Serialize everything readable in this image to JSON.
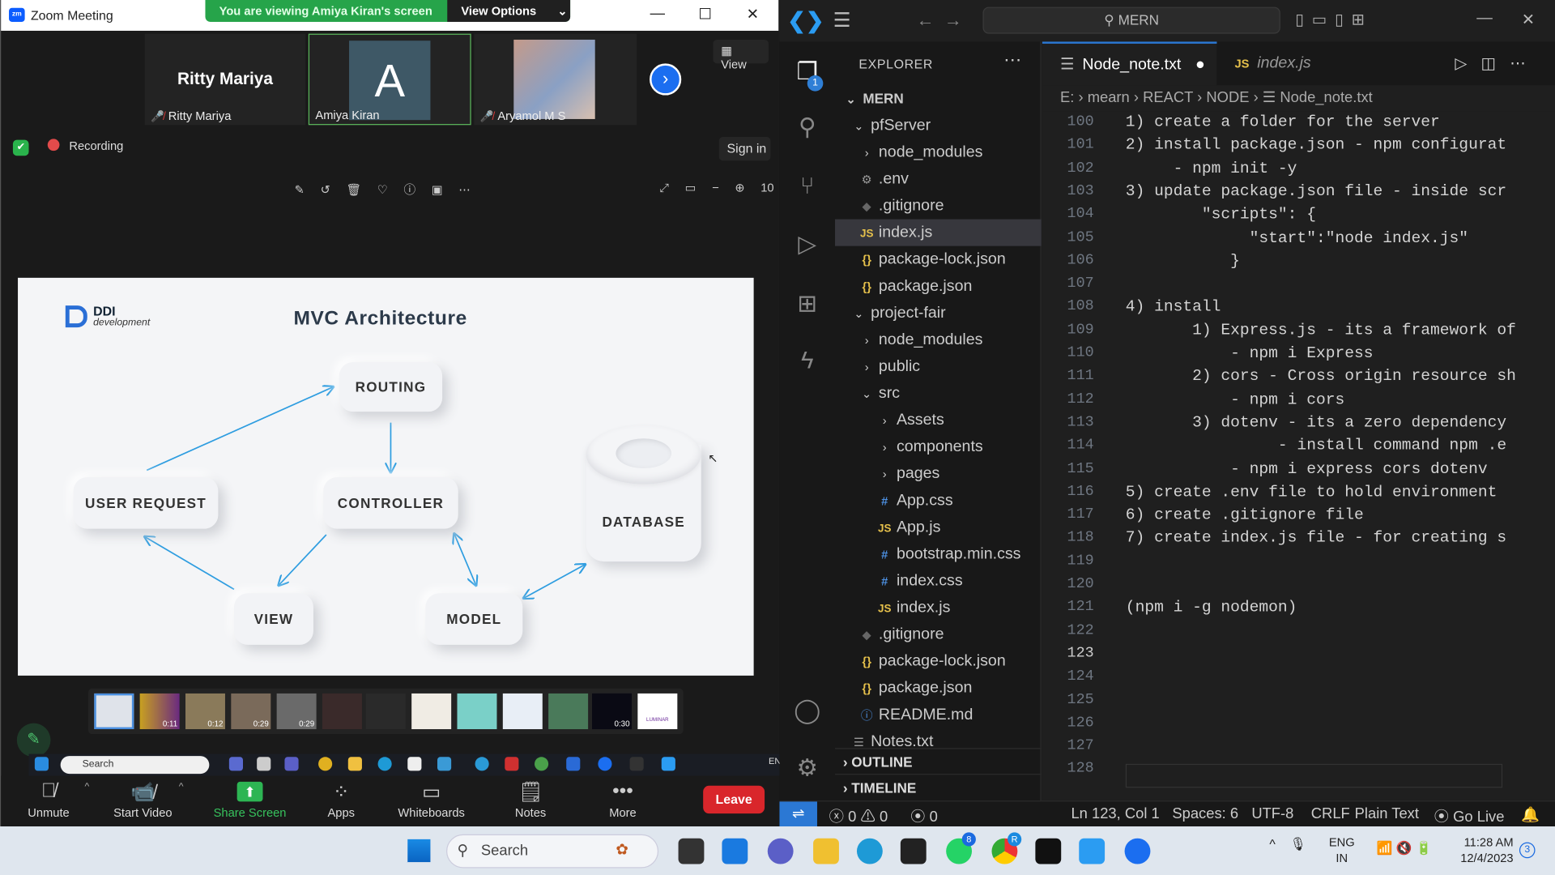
{
  "zoom": {
    "window_title": "Zoom Meeting",
    "viewing_banner": "You are viewing Amiya Kiran's screen",
    "view_options": "View Options",
    "participants": [
      {
        "name": "Ritty Mariya",
        "display": "Ritty Mariya",
        "muted": true
      },
      {
        "name": "Amiya Kiran",
        "avatar_letter": "A",
        "muted": false
      },
      {
        "name": "Aryamol M S",
        "muted": true
      }
    ],
    "view_button": "View",
    "recording": "Recording",
    "sign_in": "Sign in",
    "zoom_level": "10",
    "slide": {
      "brand": "DDI",
      "brand_sub": "development",
      "title": "MVC Architecture",
      "nodes": {
        "routing": "ROUTING",
        "user_request": "USER REQUEST",
        "controller": "CONTROLLER",
        "database": "DATABASE",
        "view": "VIEW",
        "model": "MODEL"
      }
    },
    "thumb_times": [
      "0:11",
      "0:12",
      "0:29",
      "0:29",
      "0:30"
    ],
    "thumb_brand": "LUMINAR",
    "mini_search": "Search",
    "mini_lang": "EN",
    "controls": [
      {
        "label": "Unmute",
        "icon": "mic-off-icon"
      },
      {
        "label": "Start Video",
        "icon": "video-off-icon"
      },
      {
        "label": "Share Screen",
        "icon": "share-screen-icon"
      },
      {
        "label": "Apps",
        "icon": "apps-icon"
      },
      {
        "label": "Whiteboards",
        "icon": "whiteboard-icon"
      },
      {
        "label": "Notes",
        "icon": "notes-icon"
      },
      {
        "label": "More",
        "icon": "more-icon"
      }
    ],
    "leave": "Leave"
  },
  "vscode": {
    "command_center": "MERN",
    "explorer_title": "EXPLORER",
    "root": "MERN",
    "tree": [
      {
        "label": "pfServer",
        "type": "folder-open",
        "depth": 1
      },
      {
        "label": "node_modules",
        "type": "folder",
        "depth": 2
      },
      {
        "label": ".env",
        "type": "env",
        "depth": 2
      },
      {
        "label": ".gitignore",
        "type": "git",
        "depth": 2
      },
      {
        "label": "index.js",
        "type": "js",
        "depth": 2,
        "selected": true
      },
      {
        "label": "package-lock.json",
        "type": "json",
        "depth": 2
      },
      {
        "label": "package.json",
        "type": "json",
        "depth": 2
      },
      {
        "label": "project-fair",
        "type": "folder-open",
        "depth": 1
      },
      {
        "label": "node_modules",
        "type": "folder",
        "depth": 2
      },
      {
        "label": "public",
        "type": "folder",
        "depth": 2
      },
      {
        "label": "src",
        "type": "folder-open",
        "depth": 2
      },
      {
        "label": "Assets",
        "type": "folder",
        "depth": 3
      },
      {
        "label": "components",
        "type": "folder",
        "depth": 3
      },
      {
        "label": "pages",
        "type": "folder",
        "depth": 3
      },
      {
        "label": "App.css",
        "type": "css",
        "depth": 3
      },
      {
        "label": "App.js",
        "type": "js",
        "depth": 3
      },
      {
        "label": "bootstrap.min.css",
        "type": "css",
        "depth": 3
      },
      {
        "label": "index.css",
        "type": "css",
        "depth": 3
      },
      {
        "label": "index.js",
        "type": "js",
        "depth": 3
      },
      {
        "label": ".gitignore",
        "type": "git",
        "depth": 2
      },
      {
        "label": "package-lock.json",
        "type": "json",
        "depth": 2
      },
      {
        "label": "package.json",
        "type": "json",
        "depth": 2
      },
      {
        "label": "README.md",
        "type": "info",
        "depth": 2
      },
      {
        "label": "Notes.txt",
        "type": "txt",
        "depth": 1
      }
    ],
    "outline": "OUTLINE",
    "timeline": "TIMELINE",
    "tabs": [
      {
        "label": "Node_note.txt",
        "active": true,
        "dirty": true
      },
      {
        "label": "index.js",
        "active": false
      }
    ],
    "breadcrumb": [
      "E:",
      "mearn",
      "REACT",
      "NODE",
      "Node_note.txt"
    ],
    "lines": [
      {
        "n": "100",
        "t": "1) create a folder for the server"
      },
      {
        "n": "101",
        "t": "2) install package.json - npm configurat"
      },
      {
        "n": "102",
        "t": "     - npm init -y"
      },
      {
        "n": "103",
        "t": "3) update package.json file - inside scr"
      },
      {
        "n": "104",
        "t": "        \"scripts\": {"
      },
      {
        "n": "105",
        "t": "             \"start\":\"node index.js\""
      },
      {
        "n": "106",
        "t": "           }"
      },
      {
        "n": "107",
        "t": ""
      },
      {
        "n": "108",
        "t": "4) install"
      },
      {
        "n": "109",
        "t": "       1) Express.js - its a framework of"
      },
      {
        "n": "110",
        "t": "           - npm i Express"
      },
      {
        "n": "111",
        "t": "       2) cors - Cross origin resource sh"
      },
      {
        "n": "112",
        "t": "           - npm i cors"
      },
      {
        "n": "113",
        "t": "       3) dotenv - its a zero dependency"
      },
      {
        "n": "114",
        "t": "                - install command npm .e"
      },
      {
        "n": "115",
        "t": "           - npm i express cors dotenv"
      },
      {
        "n": "116",
        "t": "5) create .env file to hold environment"
      },
      {
        "n": "117",
        "t": "6) create .gitignore file"
      },
      {
        "n": "118",
        "t": "7) create index.js file - for creating s"
      },
      {
        "n": "119",
        "t": ""
      },
      {
        "n": "120",
        "t": ""
      },
      {
        "n": "121",
        "t": "(npm i -g nodemon)"
      },
      {
        "n": "122",
        "t": ""
      },
      {
        "n": "123",
        "t": ""
      },
      {
        "n": "124",
        "t": ""
      },
      {
        "n": "125",
        "t": ""
      },
      {
        "n": "126",
        "t": ""
      },
      {
        "n": "127",
        "t": ""
      },
      {
        "n": "128",
        "t": ""
      }
    ],
    "status": {
      "errors": "0",
      "warnings": "0",
      "ports": "0",
      "position": "Ln 123, Col 1",
      "spaces": "Spaces: 6",
      "encoding": "UTF-8",
      "eol": "CRLF",
      "language": "Plain Text",
      "golive": "Go Live"
    }
  },
  "taskbar": {
    "search": "Search",
    "lang1": "ENG",
    "lang2": "IN",
    "time": "11:28 AM",
    "date": "12/4/2023",
    "notif": "3",
    "whatsapp_badge": "8",
    "chrome_badge": "R"
  }
}
